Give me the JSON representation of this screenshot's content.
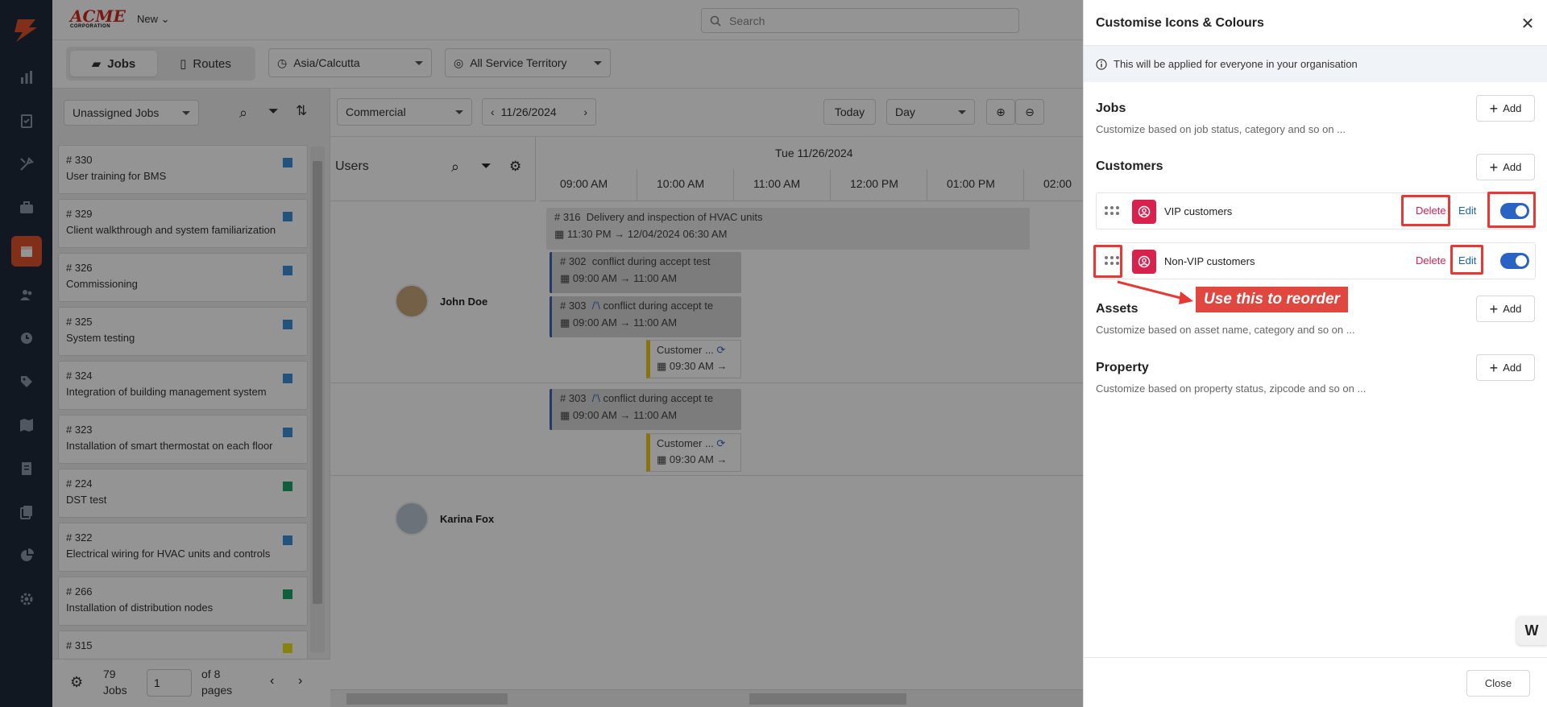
{
  "brand": {
    "logo_text": "ACME",
    "logo_sub": "CORPORATION",
    "accent": "#e0522c"
  },
  "topbar": {
    "new_label": "New",
    "search_placeholder": "Search"
  },
  "toolbar": {
    "tabs": [
      {
        "label": "Jobs"
      },
      {
        "label": "Routes"
      }
    ],
    "timezone": "Asia/Calcutta",
    "territory": "All Service Territory"
  },
  "joblist": {
    "filter": "Unassigned Jobs",
    "items": [
      {
        "num": "# 330",
        "title": "User training for BMS",
        "color": "#3a8fd6"
      },
      {
        "num": "# 329",
        "title": "Client walkthrough and system familiarization",
        "color": "#3a8fd6"
      },
      {
        "num": "# 326",
        "title": "Commissioning",
        "color": "#3a8fd6"
      },
      {
        "num": "# 325",
        "title": "System testing",
        "color": "#3a8fd6"
      },
      {
        "num": "# 324",
        "title": "Integration of building management system",
        "color": "#3a8fd6"
      },
      {
        "num": "# 323",
        "title": "Installation of smart thermostat on each floor",
        "color": "#3a8fd6"
      },
      {
        "num": "# 224",
        "title": "DST test",
        "color": "#1aa36a"
      },
      {
        "num": "# 322",
        "title": "Electrical wiring for HVAC units and controls",
        "color": "#3a8fd6"
      },
      {
        "num": "# 266",
        "title": "Installation of distribution nodes",
        "color": "#1aa36a"
      },
      {
        "num": "# 315",
        "title": "",
        "color": "#e8e21b"
      }
    ],
    "count": "79",
    "count_label": "Jobs",
    "page": "1",
    "of_pages": "of 8",
    "pages_label": "pages"
  },
  "schedule": {
    "category": "Commercial",
    "date": "11/26/2024",
    "today_label": "Today",
    "view": "Day",
    "users_label": "Users",
    "day_header": "Tue 11/26/2024",
    "hours": [
      "09:00 AM",
      "10:00 AM",
      "11:00 AM",
      "12:00 PM",
      "01:00 PM",
      "02:00"
    ],
    "top_event": {
      "num": "# 316",
      "title": "Delivery and inspection of HVAC units",
      "time": "11:30 PM → 12/04/2024 06:30 AM"
    },
    "users": [
      {
        "name": "John Doe"
      },
      {
        "name": "Karina Fox"
      }
    ],
    "events": [
      {
        "num": "# 302",
        "title": "conflict during accept test",
        "time": "09:00 AM → 11:00 AM"
      },
      {
        "num": "# 303",
        "title": "conflict during accept te",
        "time": "09:00 AM → 11:00 AM"
      },
      {
        "num": "# 303",
        "title": "conflict during accept te",
        "time": "09:00 AM → 11:00 AM"
      }
    ],
    "customer_events": [
      {
        "title": "Customer ...",
        "time": "09:30 AM →"
      },
      {
        "title": "Customer ...",
        "time": "09:30 AM →"
      }
    ]
  },
  "drawer": {
    "title": "Customise Icons & Colours",
    "info": "This will be applied for everyone in your organisation",
    "add_label": "Add",
    "sections": {
      "jobs": {
        "title": "Jobs",
        "subtitle": "Customize based on job status, category and so on ..."
      },
      "customers": {
        "title": "Customers"
      },
      "assets": {
        "title": "Assets",
        "subtitle": "Customize based on asset name, category and so on ..."
      },
      "property": {
        "title": "Property",
        "subtitle": "Customize based on property status, zipcode and so on ..."
      }
    },
    "customers": [
      {
        "name": "VIP customers",
        "delete": "Delete",
        "edit": "Edit",
        "enabled": true
      },
      {
        "name": "Non-VIP customers",
        "delete": "Delete",
        "edit": "Edit",
        "enabled": true
      }
    ],
    "callout": "Use this to reorder",
    "close_label": "Close"
  }
}
